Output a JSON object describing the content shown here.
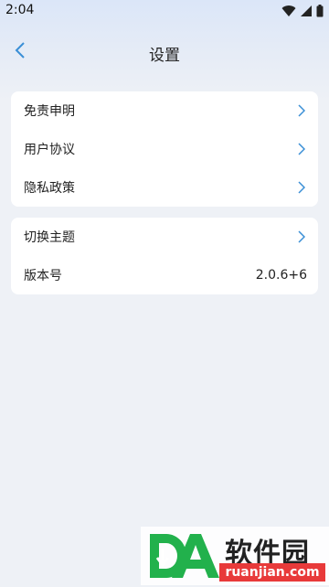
{
  "status_bar": {
    "time": "2:04"
  },
  "header": {
    "title": "设置"
  },
  "groups": [
    {
      "items": [
        {
          "label": "免责申明"
        },
        {
          "label": "用户协议"
        },
        {
          "label": "隐私政策"
        }
      ]
    },
    {
      "items": [
        {
          "label": "切换主题"
        },
        {
          "label": "版本号",
          "value": "2.0.6+6"
        }
      ]
    }
  ],
  "watermark": {
    "text_cn": "软件园",
    "text_en": "ruanjian.com"
  },
  "colors": {
    "accent": "#3a8fd6",
    "background": "#eef1f6",
    "card": "#ffffff"
  }
}
